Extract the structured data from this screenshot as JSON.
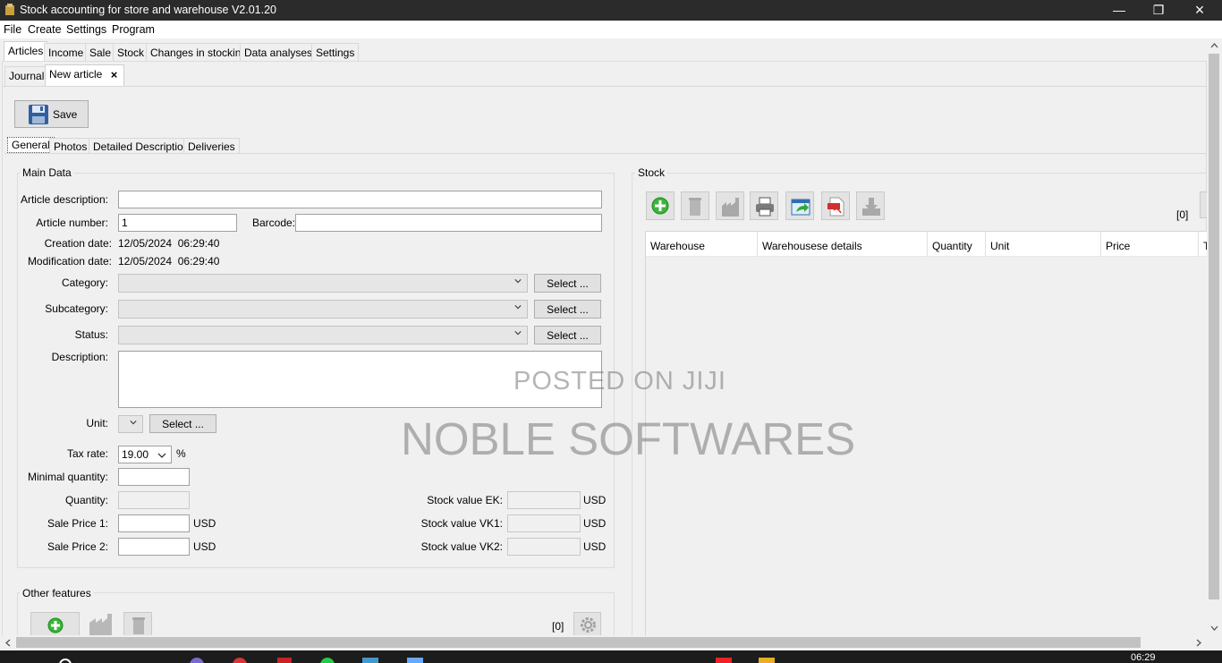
{
  "window": {
    "title": "Stock accounting for store and warehouse V2.01.20"
  },
  "menu": [
    "File",
    "Create",
    "Settings",
    "Program"
  ],
  "main_tabs": [
    "Articles",
    "Income",
    "Sale",
    "Stock",
    "Changes in stocking",
    "Data analyses",
    "Settings"
  ],
  "doc_tabs": {
    "journal": "Journal",
    "new_article": "New article",
    "close": "×"
  },
  "toolbar": {
    "save": "Save"
  },
  "sub_tabs": [
    "General",
    "Photos",
    "Detailed Description",
    "Deliveries"
  ],
  "main_data": {
    "title": "Main Data",
    "article_description_label": "Article description:",
    "article_description_value": "",
    "article_number_label": "Article number:",
    "article_number_value": "1",
    "barcode_label": "Barcode:",
    "barcode_value": "",
    "creation_date_label": "Creation date:",
    "creation_date_value": "12/05/2024  06:29:40",
    "modification_date_label": "Modification date:",
    "modification_date_value": "12/05/2024  06:29:40",
    "category_label": "Category:",
    "subcategory_label": "Subcategory:",
    "status_label": "Status:",
    "select_button": "Select ...",
    "description_label": "Description:",
    "unit_label": "Unit:",
    "tax_rate_label": "Tax rate:",
    "tax_rate_value": "19.00",
    "percent": "%",
    "minimal_quantity_label": "Minimal quantity:",
    "quantity_label": "Quantity:",
    "sale_price_1_label": "Sale Price 1:",
    "sale_price_2_label": "Sale Price 2:",
    "stock_value_ek_label": "Stock value EK:",
    "stock_value_vk1_label": "Stock value VK1:",
    "stock_value_vk2_label": "Stock value VK2:",
    "currency": "USD"
  },
  "other_features": {
    "title": "Other features",
    "count": "[0]"
  },
  "stock": {
    "title": "Stock",
    "count": "[0]",
    "columns": [
      "Warehouse",
      "Warehousese details",
      "Quantity",
      "Unit",
      "Price",
      "T"
    ]
  },
  "watermark": {
    "line1": "POSTED ON JIJI",
    "line2": "NOBLE SOFTWARES"
  },
  "taskbar": {
    "time": "06:29"
  },
  "colors": {
    "titlebar": "#2b2b2b",
    "add_green": "#3cb43c",
    "pdf_red": "#d32f2f"
  }
}
